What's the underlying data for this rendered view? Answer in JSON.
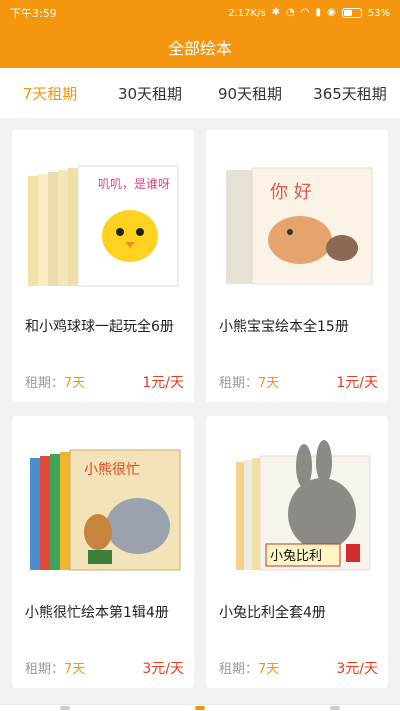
{
  "status_bar": {
    "time": "下午3:59",
    "network_speed": "2.17K/s",
    "battery_percent": "53%",
    "battery_level": 0.53
  },
  "header": {
    "title": "全部绘本"
  },
  "tabs": [
    {
      "label": "7天租期",
      "active": true
    },
    {
      "label": "30天租期",
      "active": false
    },
    {
      "label": "90天租期",
      "active": false
    },
    {
      "label": "365天租期",
      "active": false
    }
  ],
  "books": [
    {
      "name": "和小鸡球球一起玩全6册",
      "term_label": "租期：",
      "term_value": "7天",
      "price": "1元/天",
      "cover_text": "叽叽，是谁呀"
    },
    {
      "name": "小熊宝宝绘本全15册",
      "term_label": "租期：",
      "term_value": "7天",
      "price": "1元/天",
      "cover_text": "你 好"
    },
    {
      "name": "小熊很忙绘本第1辑4册",
      "term_label": "租期：",
      "term_value": "7天",
      "price": "3元/天",
      "cover_text": "小熊很忙"
    },
    {
      "name": "小兔比利全套4册",
      "term_label": "租期：",
      "term_value": "7天",
      "price": "3元/天",
      "cover_text": "小兔比利"
    }
  ],
  "colors": {
    "brand": "#f5960f",
    "price": "#e83a1e"
  }
}
